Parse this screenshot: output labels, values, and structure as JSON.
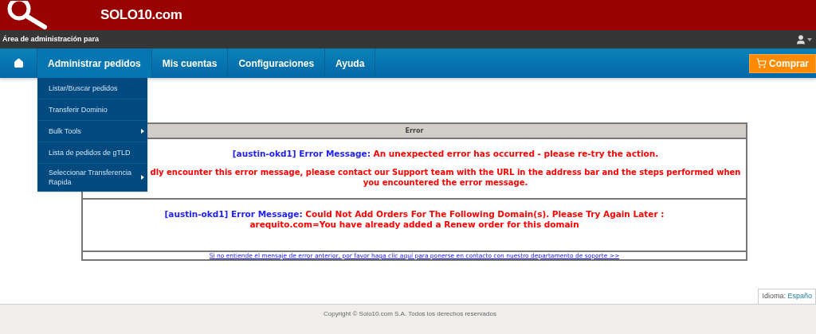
{
  "header": {
    "logo": "SOLO10.com"
  },
  "admin_bar": {
    "label": "Área de administración para"
  },
  "nav": {
    "items": [
      {
        "label": "Administrar pedidos",
        "selected": true
      },
      {
        "label": "Mis cuentas",
        "selected": false
      },
      {
        "label": "Configuraciones",
        "selected": false
      },
      {
        "label": "Ayuda",
        "selected": false
      }
    ],
    "buy_button": "Comprar"
  },
  "dropdown": {
    "items": [
      {
        "label": "Listar/Buscar pedidos",
        "has_submenu": false
      },
      {
        "label": "Transferir Dominio",
        "has_submenu": false
      },
      {
        "label": "Bulk Tools",
        "has_submenu": true
      },
      {
        "label": "Lista de pedidos de gTLD",
        "has_submenu": false
      },
      {
        "label": "Seleccionar Transferencia Rapida",
        "has_submenu": true
      }
    ]
  },
  "error_table": {
    "heading": "Error",
    "messages": [
      {
        "prefix": "[austin-okd1] Error Message:",
        "text": "An unexpected error has occurred - please re-try the action.",
        "detail": "dly encounter this error message, please contact our Support team with the URL in the address bar and the steps performed when you encountered the error message."
      },
      {
        "prefix": "[austin-okd1] Error Message:",
        "text": "Could Not Add Orders For The Following Domain(s). Please Try Again Later : arequito.com=You have already added a Renew order for this domain"
      }
    ],
    "support_link": "Si no entiende el mensaje de error anterior, por favor haga clic aquí para ponerse en contacto con nuestro departamento de soporte >>"
  },
  "language": {
    "label": "Idioma:",
    "value": "Españo"
  },
  "footer": {
    "copyright": "Copyright © Solo10.com S.A. Todos los derechos reservados"
  }
}
